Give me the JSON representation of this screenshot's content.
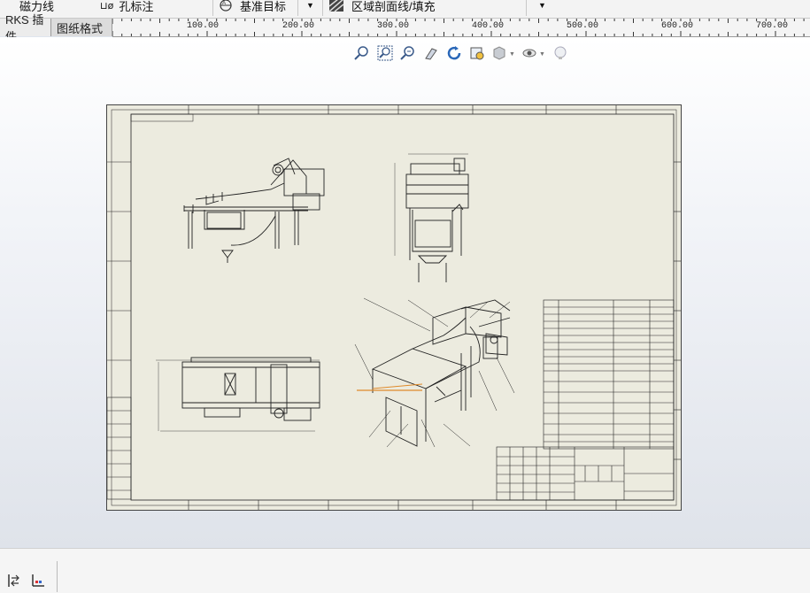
{
  "toolbar": {
    "magnetic_line": "磁力线",
    "hole_callout": "孔标注",
    "datum_target": "基准目标",
    "area_hatch": "区域剖面线/填充"
  },
  "tabs": [
    {
      "label": "RKS 插件"
    },
    {
      "label": "图纸格式"
    }
  ],
  "ruler": {
    "labels": [
      "100.00",
      "200.00",
      "300.00",
      "400.00",
      "500.00",
      "600.00",
      "700.00"
    ]
  },
  "hud": {
    "icons": [
      "zoom-to-fit-icon",
      "zoom-to-area-icon",
      "zoom-in-out-icon",
      "pan-icon",
      "rotate-icon",
      "previous-view-icon",
      "display-style-icon",
      "hide-show-icon",
      "lighting-icon"
    ]
  },
  "drawing": {
    "sheet_color": "#ecebdf",
    "line_color": "#222222",
    "highlight_color": "#e08a2a"
  },
  "statusbar": {
    "icons": [
      "model-view-icon",
      "axis-indicator-icon"
    ]
  }
}
